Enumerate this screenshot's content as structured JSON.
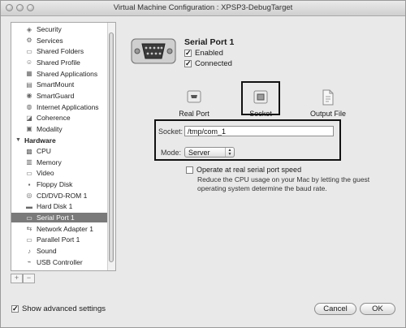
{
  "window": {
    "title": "Virtual Machine Configuration : XPSP3-DebugTarget"
  },
  "sidebar": {
    "items": [
      {
        "label": "Security",
        "icon": "shield-icon"
      },
      {
        "label": "Services",
        "icon": "gears-icon"
      },
      {
        "label": "Shared Folders",
        "icon": "folder-icon"
      },
      {
        "label": "Shared Profile",
        "icon": "profile-icon"
      },
      {
        "label": "Shared Applications",
        "icon": "applications-icon"
      },
      {
        "label": "SmartMount",
        "icon": "smartmount-icon"
      },
      {
        "label": "SmartGuard",
        "icon": "smartguard-icon"
      },
      {
        "label": "Internet Applications",
        "icon": "globe-icon"
      },
      {
        "label": "Coherence",
        "icon": "coherence-icon"
      },
      {
        "label": "Modality",
        "icon": "modality-icon"
      }
    ],
    "hardware_section": "Hardware",
    "hardware_items": [
      {
        "label": "CPU",
        "icon": "cpu-icon"
      },
      {
        "label": "Memory",
        "icon": "memory-icon"
      },
      {
        "label": "Video",
        "icon": "video-icon"
      },
      {
        "label": "Floppy Disk",
        "icon": "floppy-disk-icon"
      },
      {
        "label": "CD/DVD-ROM 1",
        "icon": "cd-dvd-icon"
      },
      {
        "label": "Hard Disk 1",
        "icon": "hard-disk-icon"
      },
      {
        "label": "Serial Port 1",
        "icon": "serial-port-icon",
        "selected": true
      },
      {
        "label": "Network Adapter 1",
        "icon": "network-icon"
      },
      {
        "label": "Parallel Port 1",
        "icon": "parallel-port-icon"
      },
      {
        "label": "Sound",
        "icon": "sound-icon"
      },
      {
        "label": "USB Controller",
        "icon": "usb-icon"
      }
    ],
    "add_label": "+",
    "remove_label": "−"
  },
  "device": {
    "title": "Serial Port 1",
    "enabled_label": "Enabled",
    "enabled": true,
    "connected_label": "Connected",
    "connected": true
  },
  "connection": {
    "options": [
      {
        "label": "Real Port",
        "icon": "real-port-icon"
      },
      {
        "label": "Socket",
        "icon": "socket-icon",
        "selected": true
      },
      {
        "label": "Output File",
        "icon": "output-file-icon"
      }
    ],
    "socket_label": "Socket:",
    "socket_value": "/tmp/com_1",
    "mode_label": "Mode:",
    "mode_value": "Server",
    "real_speed_label": "Operate at real serial port speed",
    "real_speed_help": "Reduce the CPU usage on your Mac by letting the guest operating system determine the baud rate."
  },
  "footer": {
    "advanced_label": "Show advanced settings",
    "advanced_checked": true,
    "cancel_label": "Cancel",
    "ok_label": "OK"
  },
  "colors": {
    "selection": "#7a7a7a",
    "window_bg": "#e9e9e9"
  }
}
